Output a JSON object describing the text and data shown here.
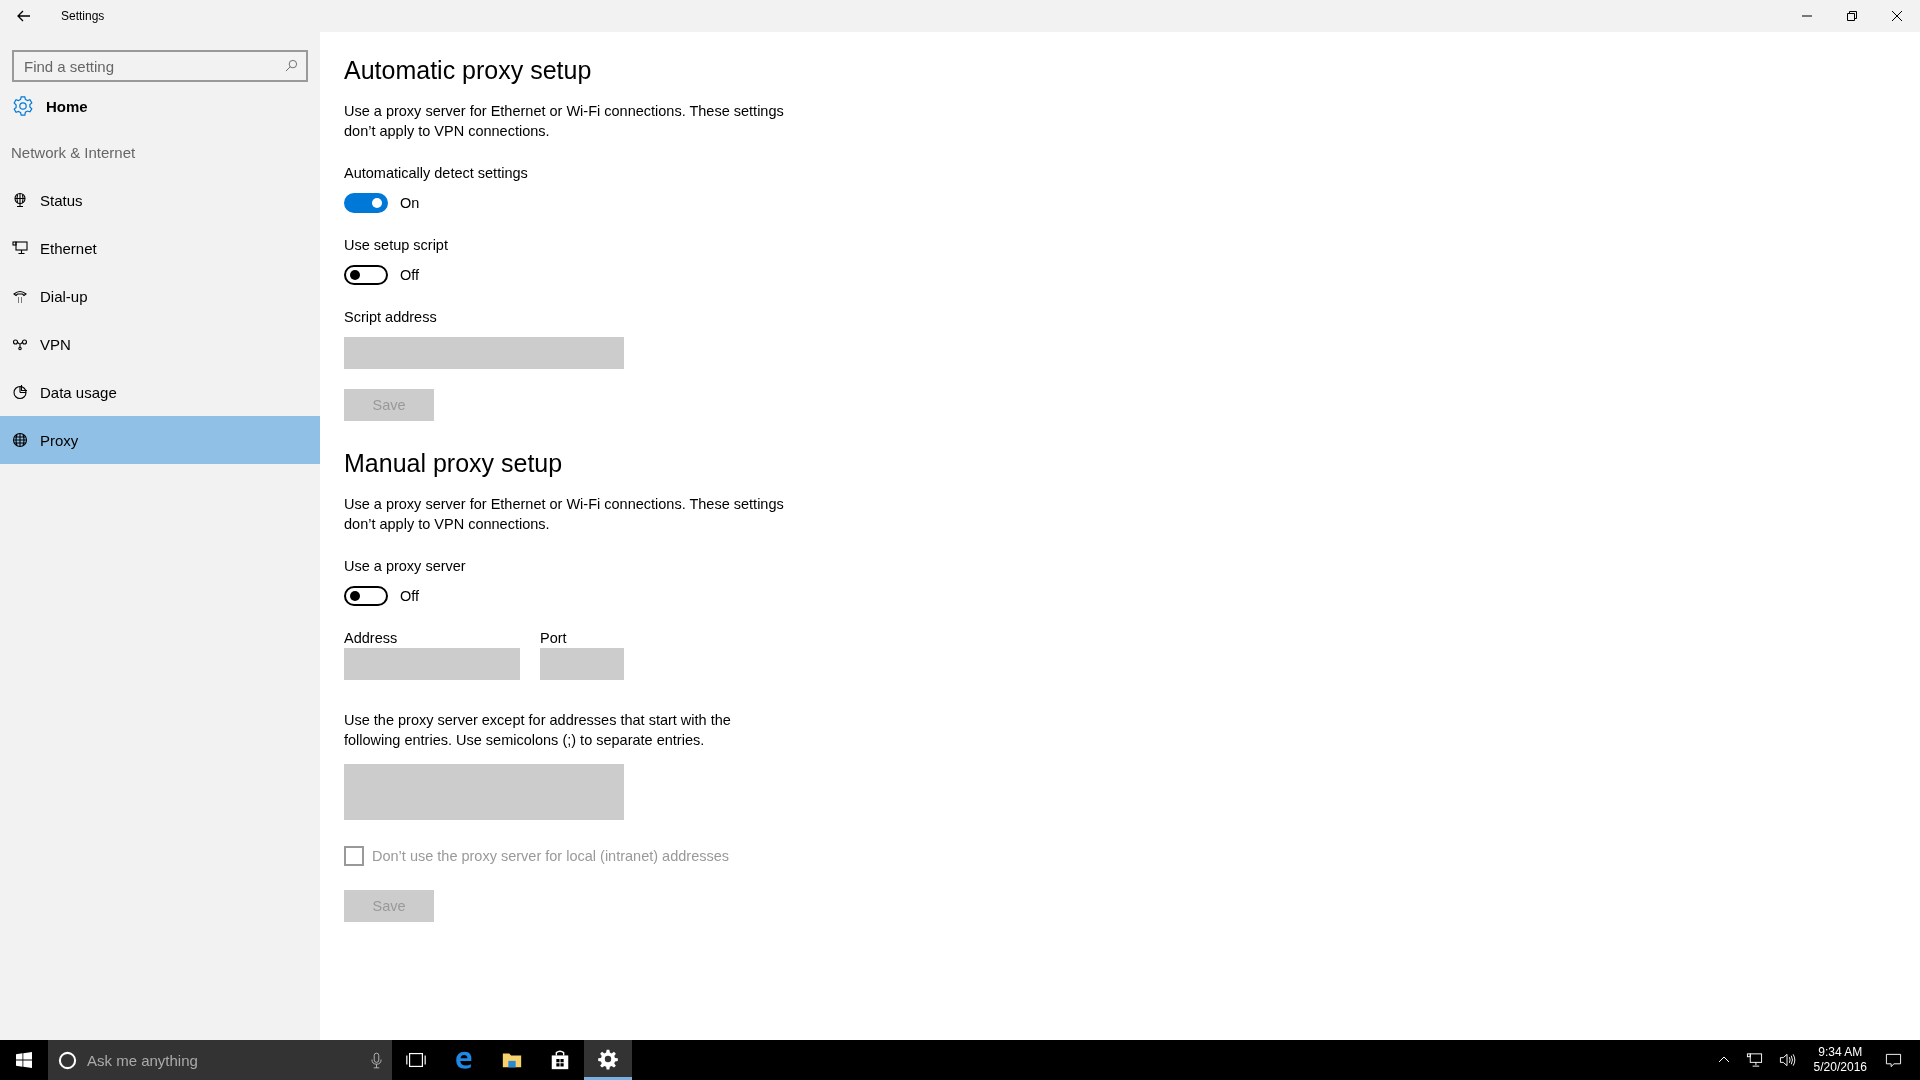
{
  "window": {
    "title": "Settings"
  },
  "sidebar": {
    "search": {
      "placeholder": "Find a setting"
    },
    "home": "Home",
    "section": "Network & Internet",
    "items": [
      {
        "label": "Status",
        "selected": false
      },
      {
        "label": "Ethernet",
        "selected": false
      },
      {
        "label": "Dial-up",
        "selected": false
      },
      {
        "label": "VPN",
        "selected": false
      },
      {
        "label": "Data usage",
        "selected": false
      },
      {
        "label": "Proxy",
        "selected": true
      }
    ]
  },
  "sections": [
    {
      "heading": "Automatic proxy setup",
      "description": "Use a proxy server for Ethernet or Wi-Fi connections. These settings don’t apply to VPN connections.",
      "controls": [
        {
          "kind": "toggle",
          "label": "Automatically detect settings",
          "on": true,
          "state_text": "On"
        },
        {
          "kind": "toggle",
          "label": "Use setup script",
          "on": false,
          "state_text": "Off"
        },
        {
          "kind": "field",
          "label": "Script address",
          "disabled": true
        },
        {
          "kind": "button",
          "label": "Save",
          "disabled": true
        }
      ]
    },
    {
      "heading": "Manual proxy setup",
      "description": "Use a proxy server for Ethernet or Wi-Fi connections. These settings don’t apply to VPN connections.",
      "controls": [
        {
          "kind": "toggle",
          "label": "Use a proxy server",
          "on": false,
          "state_text": "Off"
        },
        {
          "kind": "fields",
          "fields": [
            {
              "label": "Address",
              "disabled": true
            },
            {
              "label": "Port",
              "disabled": true
            }
          ]
        },
        {
          "kind": "note",
          "text": "Use the proxy server except for addresses that start with the following entries. Use semicolons (;) to separate entries."
        },
        {
          "kind": "textarea",
          "disabled": true
        },
        {
          "kind": "checkbox",
          "label": "Don’t use the proxy server for local (intranet) addresses",
          "checked": false,
          "disabled": true
        },
        {
          "kind": "button",
          "label": "Save",
          "disabled": true
        }
      ]
    }
  ],
  "taskbar": {
    "search": {
      "placeholder": "Ask me anything"
    },
    "apps": [
      {
        "selected": false
      },
      {
        "selected": false
      },
      {
        "selected": false
      },
      {
        "selected": false
      },
      {
        "selected": true
      }
    ],
    "clock": {
      "time": "9:34 AM",
      "date": "5/20/2016"
    }
  }
}
